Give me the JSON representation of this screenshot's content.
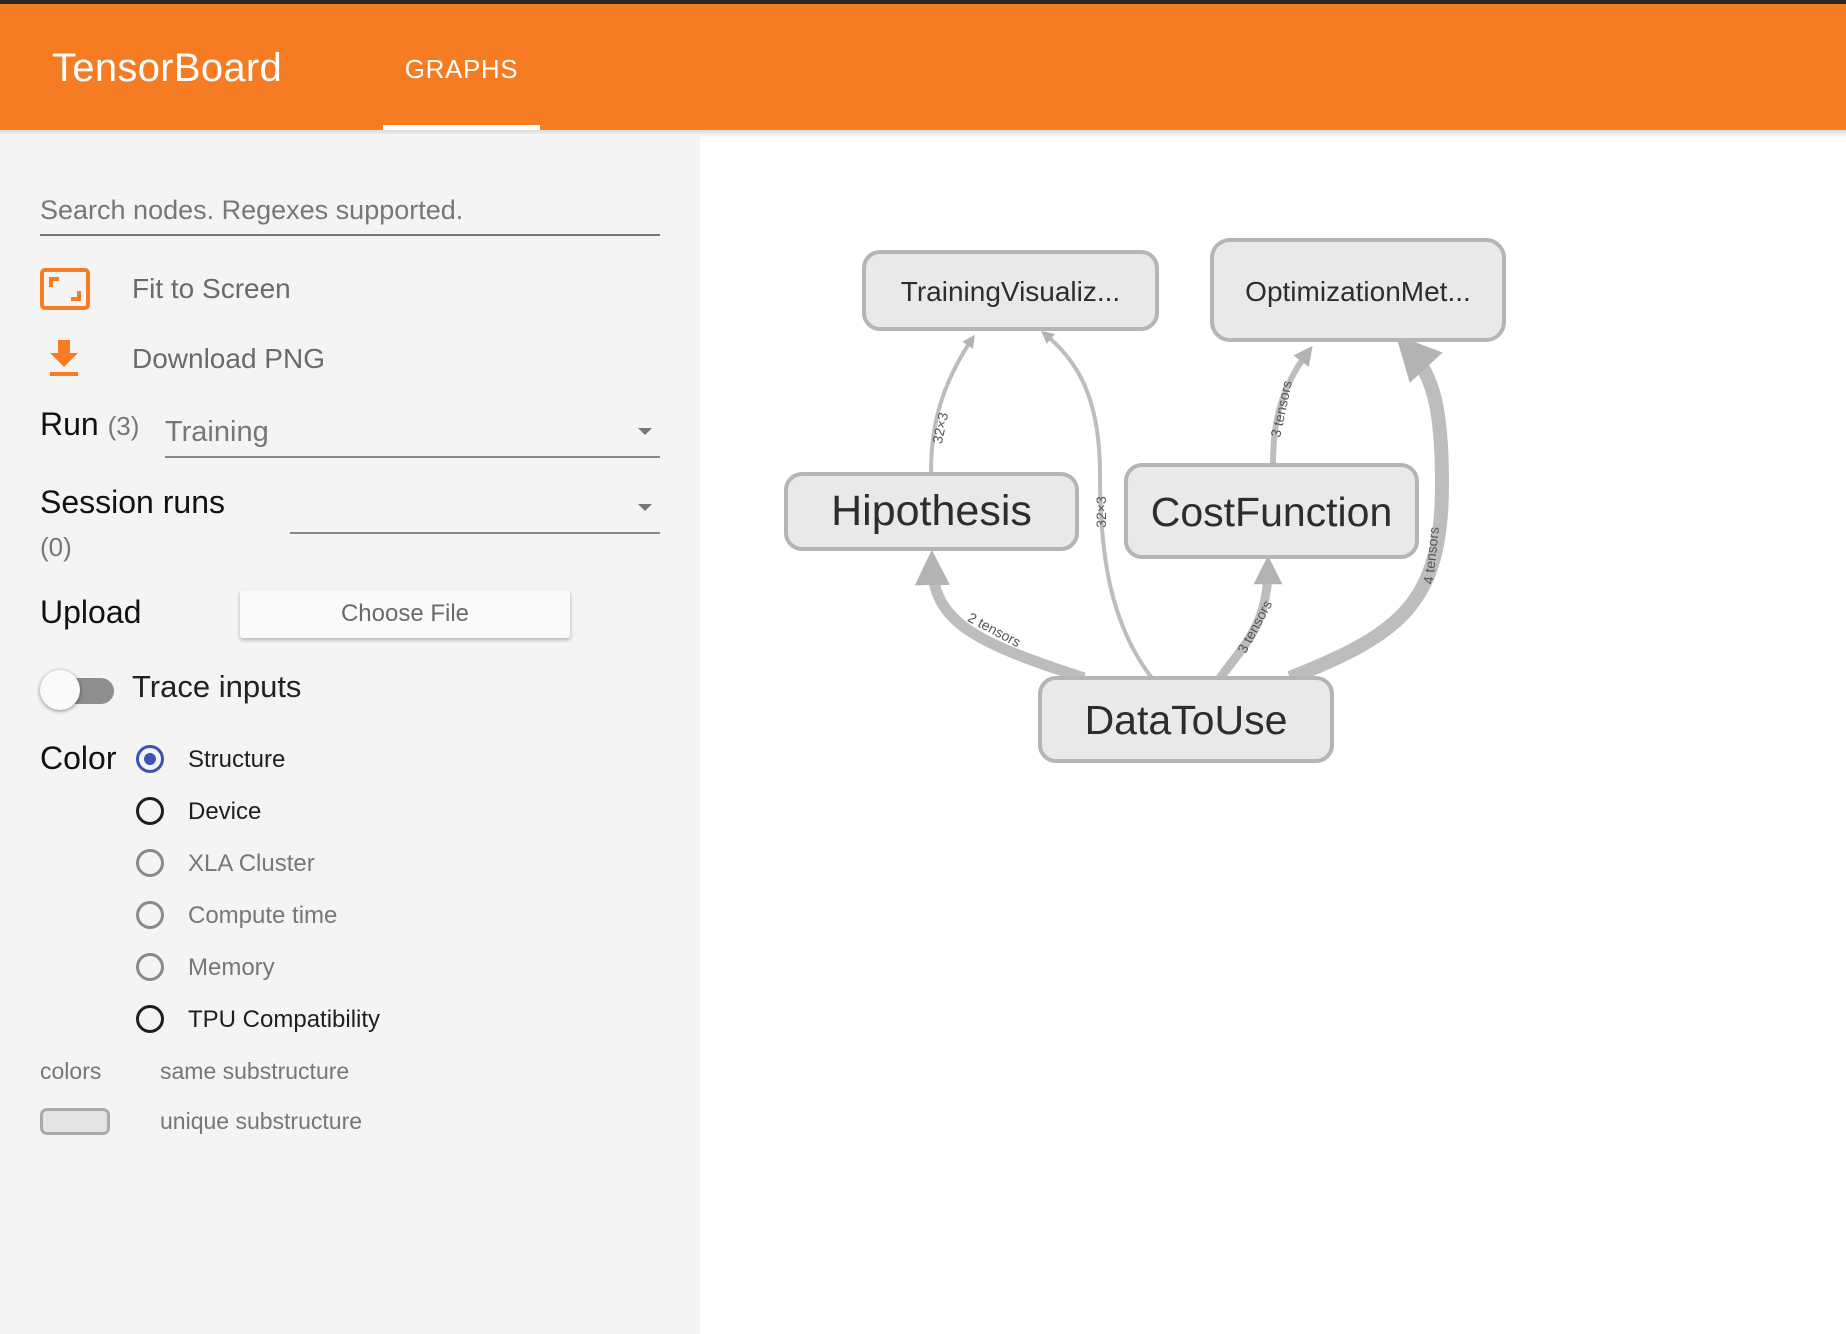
{
  "header": {
    "brand": "TensorBoard",
    "tabs": [
      {
        "label": "GRAPHS",
        "active": true
      }
    ],
    "accent_color": "#f57c22"
  },
  "sidebar": {
    "search": {
      "placeholder": "Search nodes. Regexes supported.",
      "value": ""
    },
    "fit_to_screen": {
      "label": "Fit to Screen",
      "icon": "fit-screen-icon"
    },
    "download_png": {
      "label": "Download PNG",
      "icon": "download-icon"
    },
    "run": {
      "label": "Run",
      "count": "(3)",
      "selected": "Training"
    },
    "session_runs": {
      "label": "Session runs",
      "count": "(0)",
      "selected": ""
    },
    "upload": {
      "label": "Upload",
      "button": "Choose File"
    },
    "trace_inputs": {
      "label": "Trace inputs",
      "on": false
    },
    "color": {
      "label": "Color",
      "options": [
        {
          "label": "Structure",
          "selected": true
        },
        {
          "label": "Device",
          "selected": false
        },
        {
          "label": "XLA Cluster",
          "selected": false
        },
        {
          "label": "Compute time",
          "selected": false
        },
        {
          "label": "Memory",
          "selected": false
        },
        {
          "label": "TPU Compatibility",
          "selected": false
        }
      ]
    },
    "colors_legend": {
      "label": "colors",
      "items": [
        "same substructure",
        "unique substructure"
      ]
    }
  },
  "graph": {
    "nodes": [
      {
        "id": "training",
        "label": "TrainingVisualiz..."
      },
      {
        "id": "optimization",
        "label": "OptimizationMet..."
      },
      {
        "id": "hipothesis",
        "label": "Hipothesis"
      },
      {
        "id": "cost",
        "label": "CostFunction"
      },
      {
        "id": "data",
        "label": "DataToUse"
      }
    ],
    "edges": [
      {
        "from": "hipothesis",
        "to": "training",
        "label": "32×3"
      },
      {
        "from": "data",
        "to": "training",
        "label": "32×3"
      },
      {
        "from": "data",
        "to": "hipothesis",
        "label": "2 tensors"
      },
      {
        "from": "cost",
        "to": "optimization",
        "label": "3 tensors"
      },
      {
        "from": "data",
        "to": "cost",
        "label": "3 tensors"
      },
      {
        "from": "data",
        "to": "optimization",
        "label": "4 tensors"
      }
    ]
  }
}
